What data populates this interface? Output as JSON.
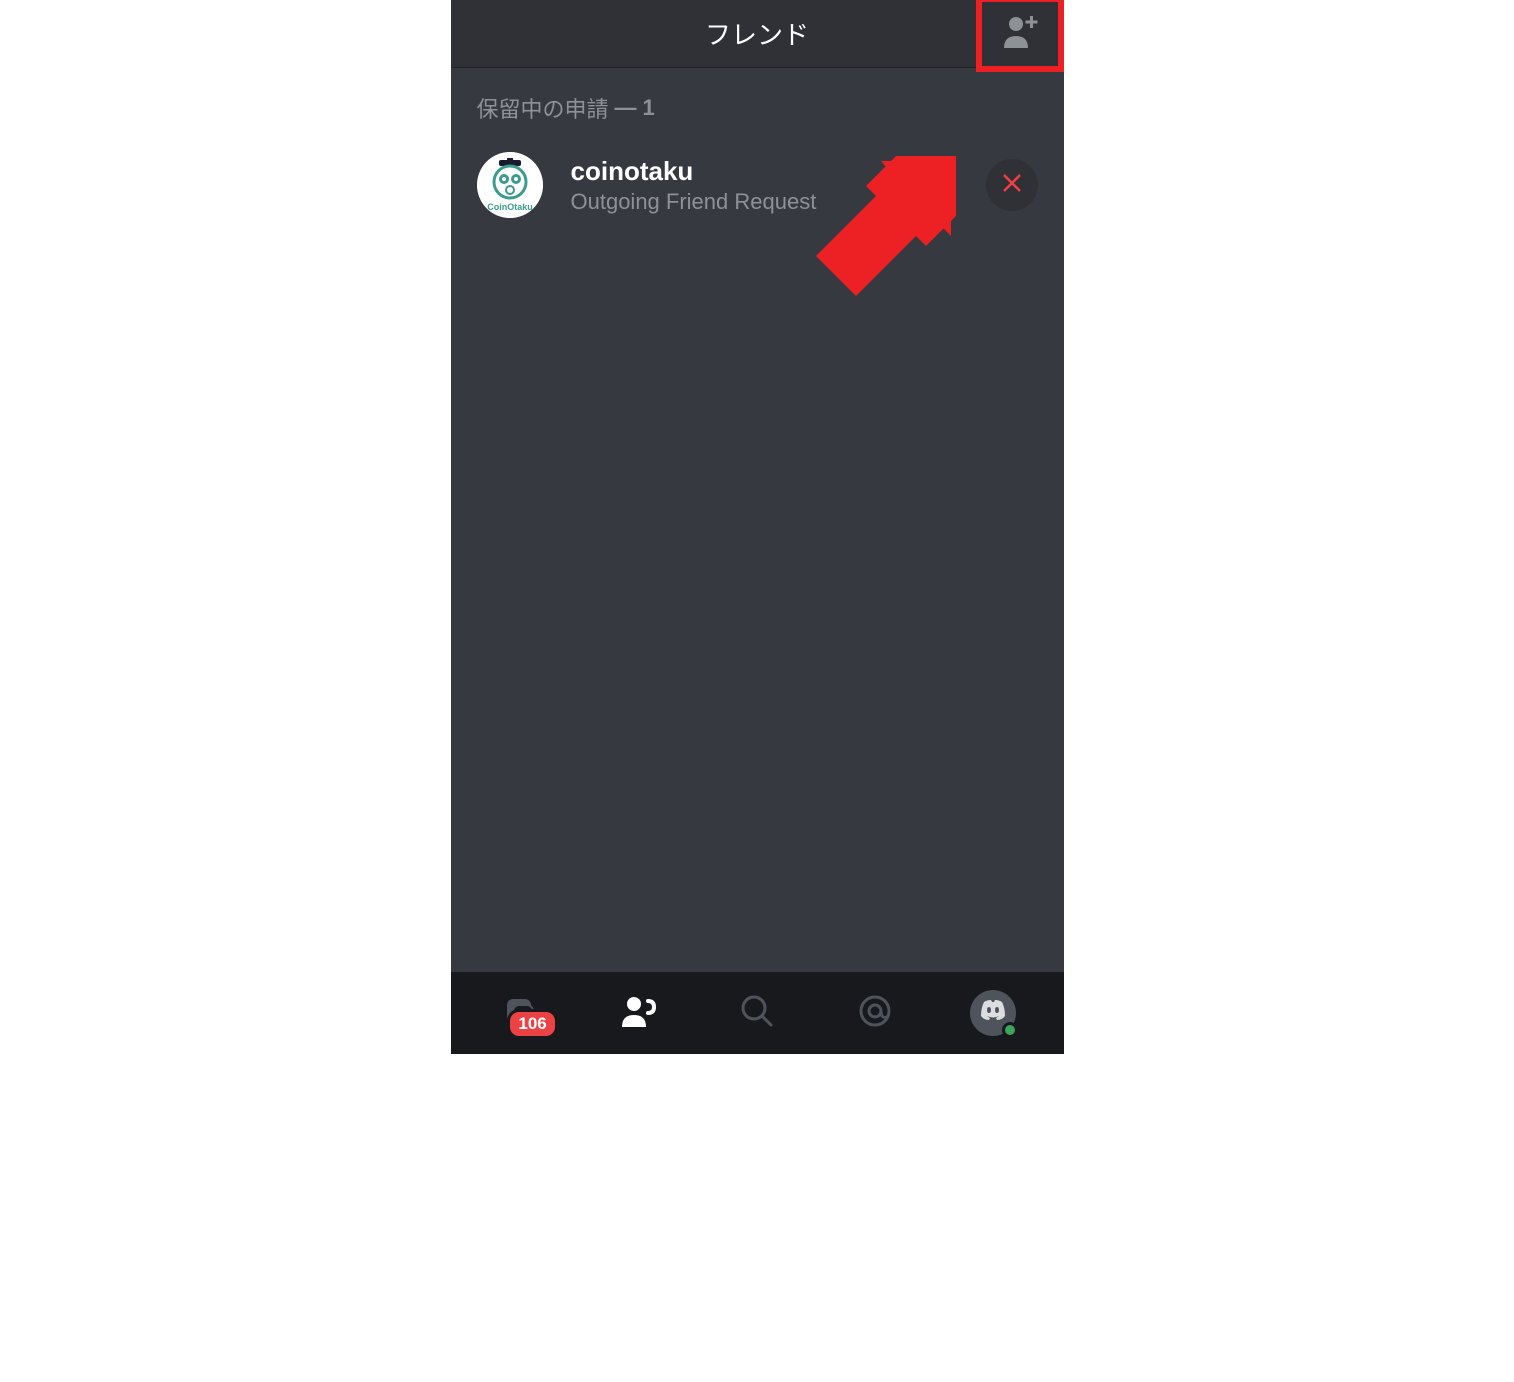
{
  "header": {
    "title": "フレンド"
  },
  "pending": {
    "label": "保留中の申請",
    "count": "1"
  },
  "requests": [
    {
      "username": "coinotaku",
      "status": "Outgoing Friend Request",
      "avatar_label": "CoinOtaku"
    }
  ],
  "nav": {
    "badge_count": "106"
  },
  "colors": {
    "highlight": "#ed2024",
    "bg_main": "#36393f",
    "bg_header": "#2f3136",
    "bg_nav": "#18191c",
    "text_muted": "#8e9297",
    "danger": "#f23f42",
    "badge": "#ed4245"
  }
}
